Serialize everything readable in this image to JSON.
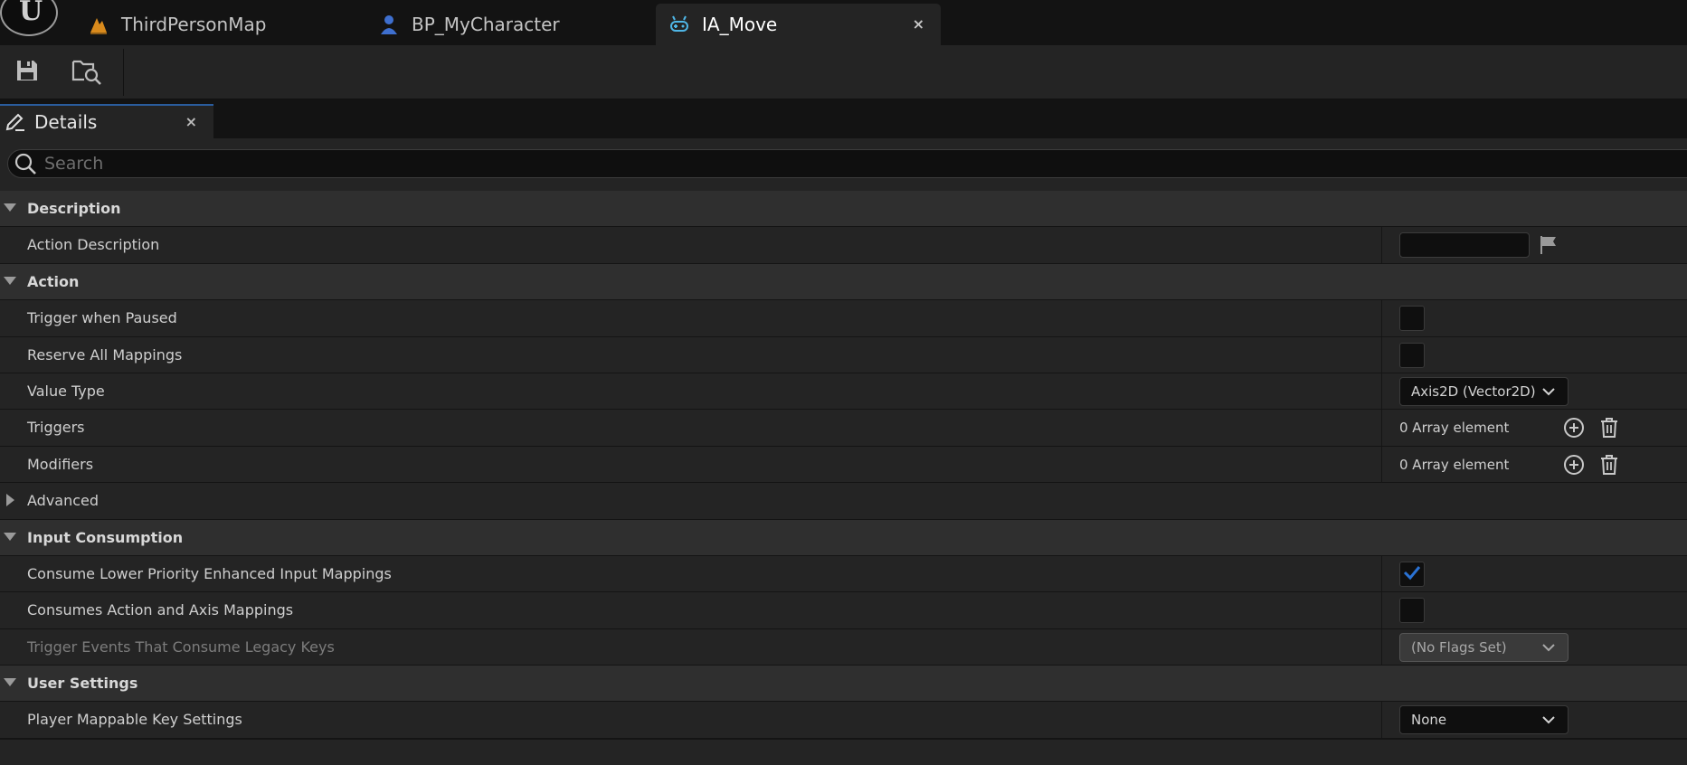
{
  "tabs": [
    {
      "label": "ThirdPersonMap",
      "icon": "level-map-icon"
    },
    {
      "label": "BP_MyCharacter",
      "icon": "character-blueprint-icon"
    },
    {
      "label": "IA_Move",
      "icon": "input-action-icon",
      "close": "×"
    }
  ],
  "toolbar": {
    "save_icon": "save-icon",
    "browse_icon": "browse-asset-icon"
  },
  "details_tab": {
    "label": "Details",
    "close": "×"
  },
  "search": {
    "placeholder": "Search",
    "value": ""
  },
  "categories": {
    "description": {
      "label": "Description",
      "expanded": true
    },
    "action": {
      "label": "Action",
      "expanded": true
    },
    "advanced": {
      "label": "Advanced",
      "expanded": false
    },
    "input_consumption": {
      "label": "Input Consumption",
      "expanded": true
    },
    "user_settings": {
      "label": "User Settings",
      "expanded": true
    }
  },
  "properties": {
    "action_description": {
      "label": "Action Description",
      "value": ""
    },
    "trigger_when_paused": {
      "label": "Trigger when Paused",
      "checked": false
    },
    "reserve_all_mappings": {
      "label": "Reserve All Mappings",
      "checked": false
    },
    "value_type": {
      "label": "Value Type",
      "value": "Axis2D (Vector2D)"
    },
    "triggers": {
      "label": "Triggers",
      "value": "0 Array element"
    },
    "modifiers": {
      "label": "Modifiers",
      "value": "0 Array element"
    },
    "consume_lower_priority": {
      "label": "Consume Lower Priority Enhanced Input Mappings",
      "checked": true
    },
    "consumes_action_axis": {
      "label": "Consumes Action and Axis Mappings",
      "checked": false
    },
    "trigger_events_legacy": {
      "label": "Trigger Events That Consume Legacy Keys",
      "value": "(No Flags Set)",
      "disabled": true
    },
    "player_mappable_key_settings": {
      "label": "Player Mappable Key Settings",
      "value": "None"
    }
  },
  "colors": {
    "accent": "#2a72d4",
    "background": "#242424",
    "category": "#2f2f2f"
  }
}
